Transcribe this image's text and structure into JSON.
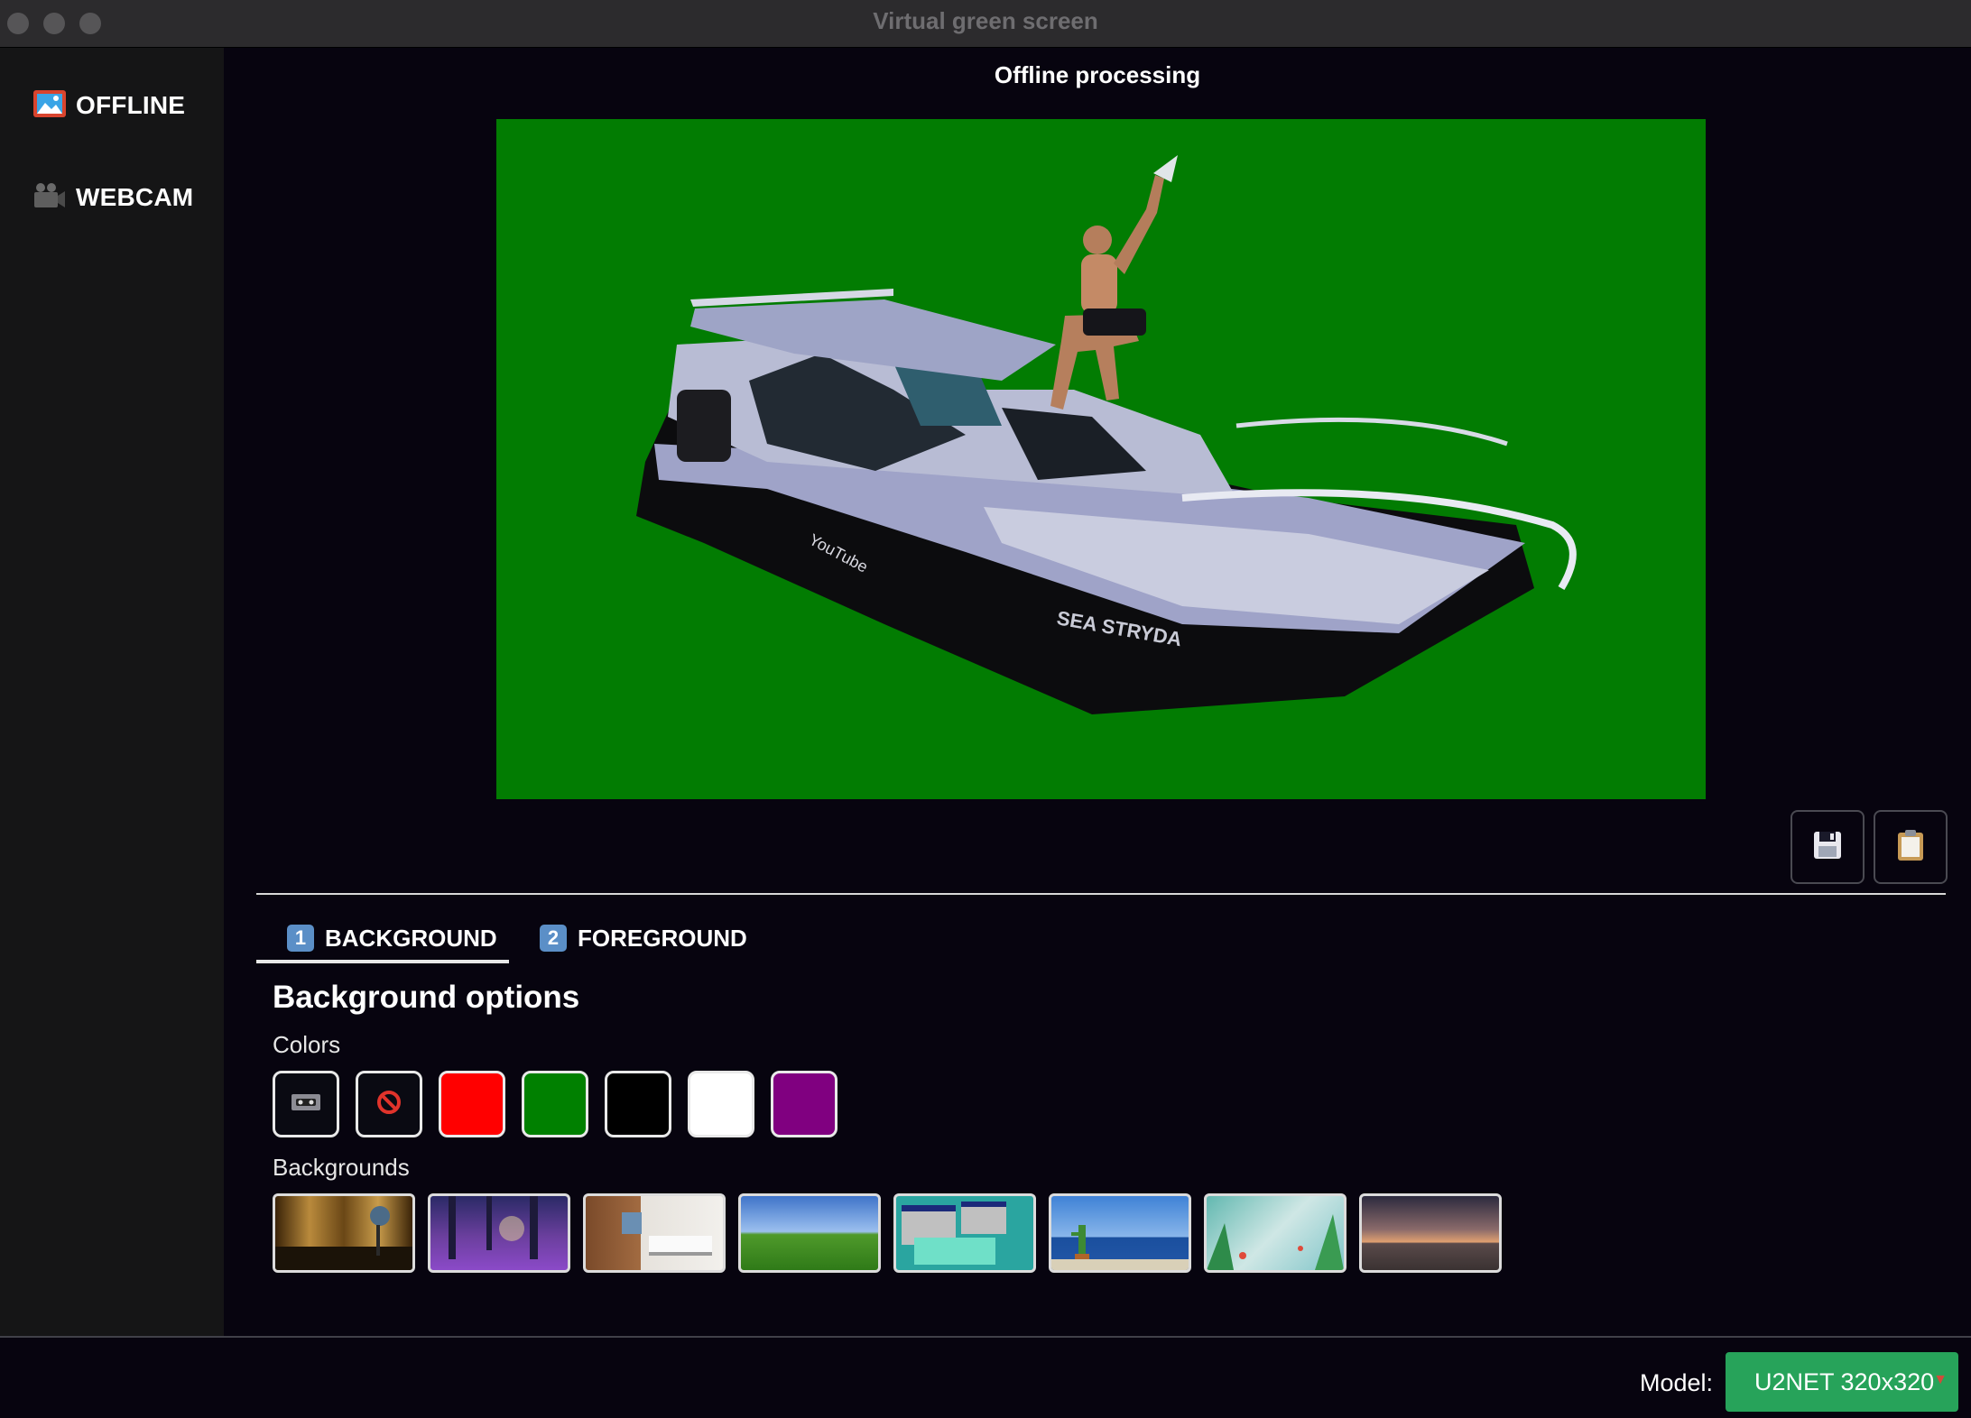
{
  "window": {
    "title": "Virtual green screen"
  },
  "sidebar": {
    "items": [
      {
        "label": "OFFLINE",
        "icon": "framed-picture-icon"
      },
      {
        "label": "WEBCAM",
        "icon": "movie-camera-icon"
      }
    ]
  },
  "main": {
    "title": "Offline processing",
    "preview_background": "#027c02",
    "toolbar": {
      "save_icon": "floppy-disk-icon",
      "copy_icon": "clipboard-icon"
    }
  },
  "tabs": [
    {
      "number": "1",
      "label": "BACKGROUND",
      "active": true
    },
    {
      "number": "2",
      "label": "FOREGROUND",
      "active": false
    }
  ],
  "options": {
    "title": "Background options",
    "colors_label": "Colors",
    "backgrounds_label": "Backgrounds",
    "colors": [
      {
        "name": "transparent",
        "icon": "video-cassette-icon"
      },
      {
        "name": "none",
        "icon": "no-entry-sign-icon"
      },
      {
        "name": "red",
        "hex": "#ff0000"
      },
      {
        "name": "green",
        "hex": "#008000"
      },
      {
        "name": "black",
        "hex": "#000000"
      },
      {
        "name": "white",
        "hex": "#ffffff"
      },
      {
        "name": "purple",
        "hex": "#800080"
      }
    ],
    "backgrounds": [
      "theater-stage",
      "purple-forest",
      "wood-office",
      "green-hill",
      "retro-desktop",
      "sea-cactus",
      "tropical-leaves",
      "sunset-beach"
    ]
  },
  "footer": {
    "model_label": "Model:",
    "model_value": "U2NET 320x320"
  }
}
